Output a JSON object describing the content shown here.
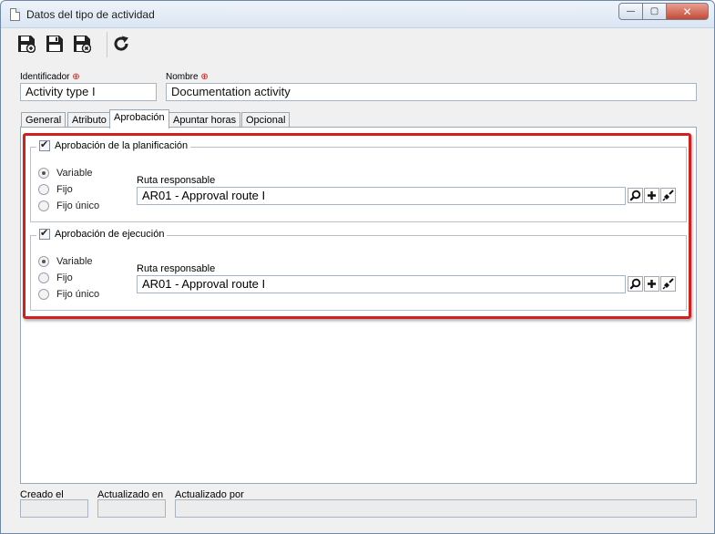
{
  "window": {
    "title": "Datos del tipo de actividad",
    "controls": {
      "minimize": "—",
      "maximize": "▢",
      "close": "✕"
    }
  },
  "toolbar": {
    "buttons": [
      {
        "name": "save-new-button",
        "icon": "save-new-icon"
      },
      {
        "name": "save-button",
        "icon": "save-icon"
      },
      {
        "name": "save-close-button",
        "icon": "save-close-icon"
      },
      {
        "name": "refresh-button",
        "icon": "refresh-icon"
      }
    ]
  },
  "form": {
    "identifier_label": "Identificador",
    "identifier_value": "Activity type I",
    "name_label": "Nombre",
    "name_value": "Documentation activity",
    "required_mark": "⊕"
  },
  "tabs": [
    {
      "label": "General",
      "active": false
    },
    {
      "label": "Atributo",
      "active": false
    },
    {
      "label": "Aprobación",
      "active": true
    },
    {
      "label": "Apuntar horas",
      "active": false
    },
    {
      "label": "Opcional",
      "active": false
    }
  ],
  "planning_approval": {
    "title": "Aprobación de la planificación",
    "checked": true,
    "options": [
      "Variable",
      "Fijo",
      "Fijo único"
    ],
    "selected": "Variable",
    "route_label": "Ruta responsable",
    "route_value": "AR01 - Approval route I"
  },
  "execution_approval": {
    "title": "Aprobación de ejecución",
    "checked": true,
    "options": [
      "Variable",
      "Fijo",
      "Fijo único"
    ],
    "selected": "Variable",
    "route_label": "Ruta responsable",
    "route_value": "AR01 - Approval route I"
  },
  "footer": {
    "created_label": "Creado el",
    "updated_label": "Actualizado en",
    "updated_by_label": "Actualizado por"
  },
  "colors": {
    "highlight": "#d41f1f",
    "required": "#d01010"
  }
}
